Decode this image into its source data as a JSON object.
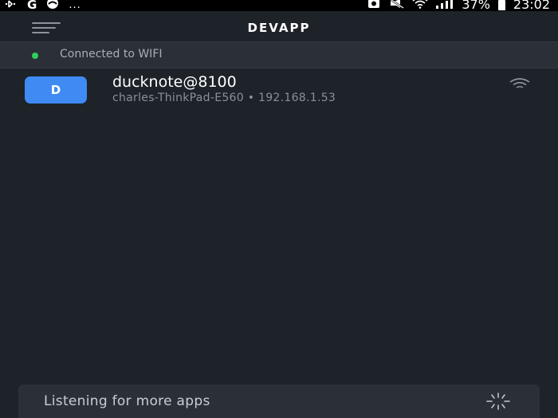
{
  "status_bar": {
    "left_icons": [
      "bluetooth-icon",
      "google-icon",
      "notification-icon",
      "more-notifications-icon"
    ],
    "google_letter": "G",
    "more_dots": "...",
    "right_icons": [
      "alarm-icon",
      "mute-icon",
      "wifi-icon",
      "signal-icon",
      "battery-icon"
    ],
    "battery": "37%",
    "time": "23:02"
  },
  "header": {
    "title": "DEVAPP"
  },
  "connection": {
    "status": "Connected to WIFI",
    "status_color": "#2fcf5b"
  },
  "devices": [
    {
      "avatar_letter": "D",
      "name": "ducknote@8100",
      "host": "charles-ThinkPad-E560 • 192.168.1.53",
      "avatar_color": "#3f8bf3"
    }
  ],
  "footer": {
    "listening_text": "Listening for more apps"
  }
}
